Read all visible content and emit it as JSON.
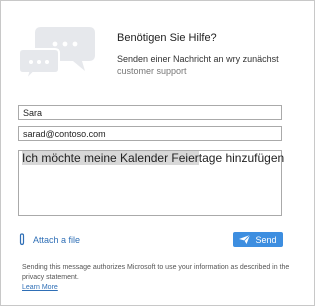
{
  "header": {
    "title": "Benötigen Sie Hilfe?",
    "subtitle_line1": "Senden einer Nachricht an wry zunächst",
    "subtitle_line2": "customer support",
    "icon": "chat-bubbles-icon"
  },
  "form": {
    "name_value": "Sara",
    "email_value": "sarad@contoso.com",
    "message_highlighted": "Ich möchte meine Kalender Feier",
    "message_rest": "tage hinzufügen"
  },
  "actions": {
    "attach_label": "Attach a file",
    "attach_icon": "paperclip-icon",
    "send_label": "Send",
    "send_icon": "paper-plane-icon",
    "accent_color": "#3d8ee0"
  },
  "footer": {
    "disclaimer": "Sending this message authorizes Microsoft to use your information as described in the privacy statement.",
    "learn_more": "Learn More"
  }
}
